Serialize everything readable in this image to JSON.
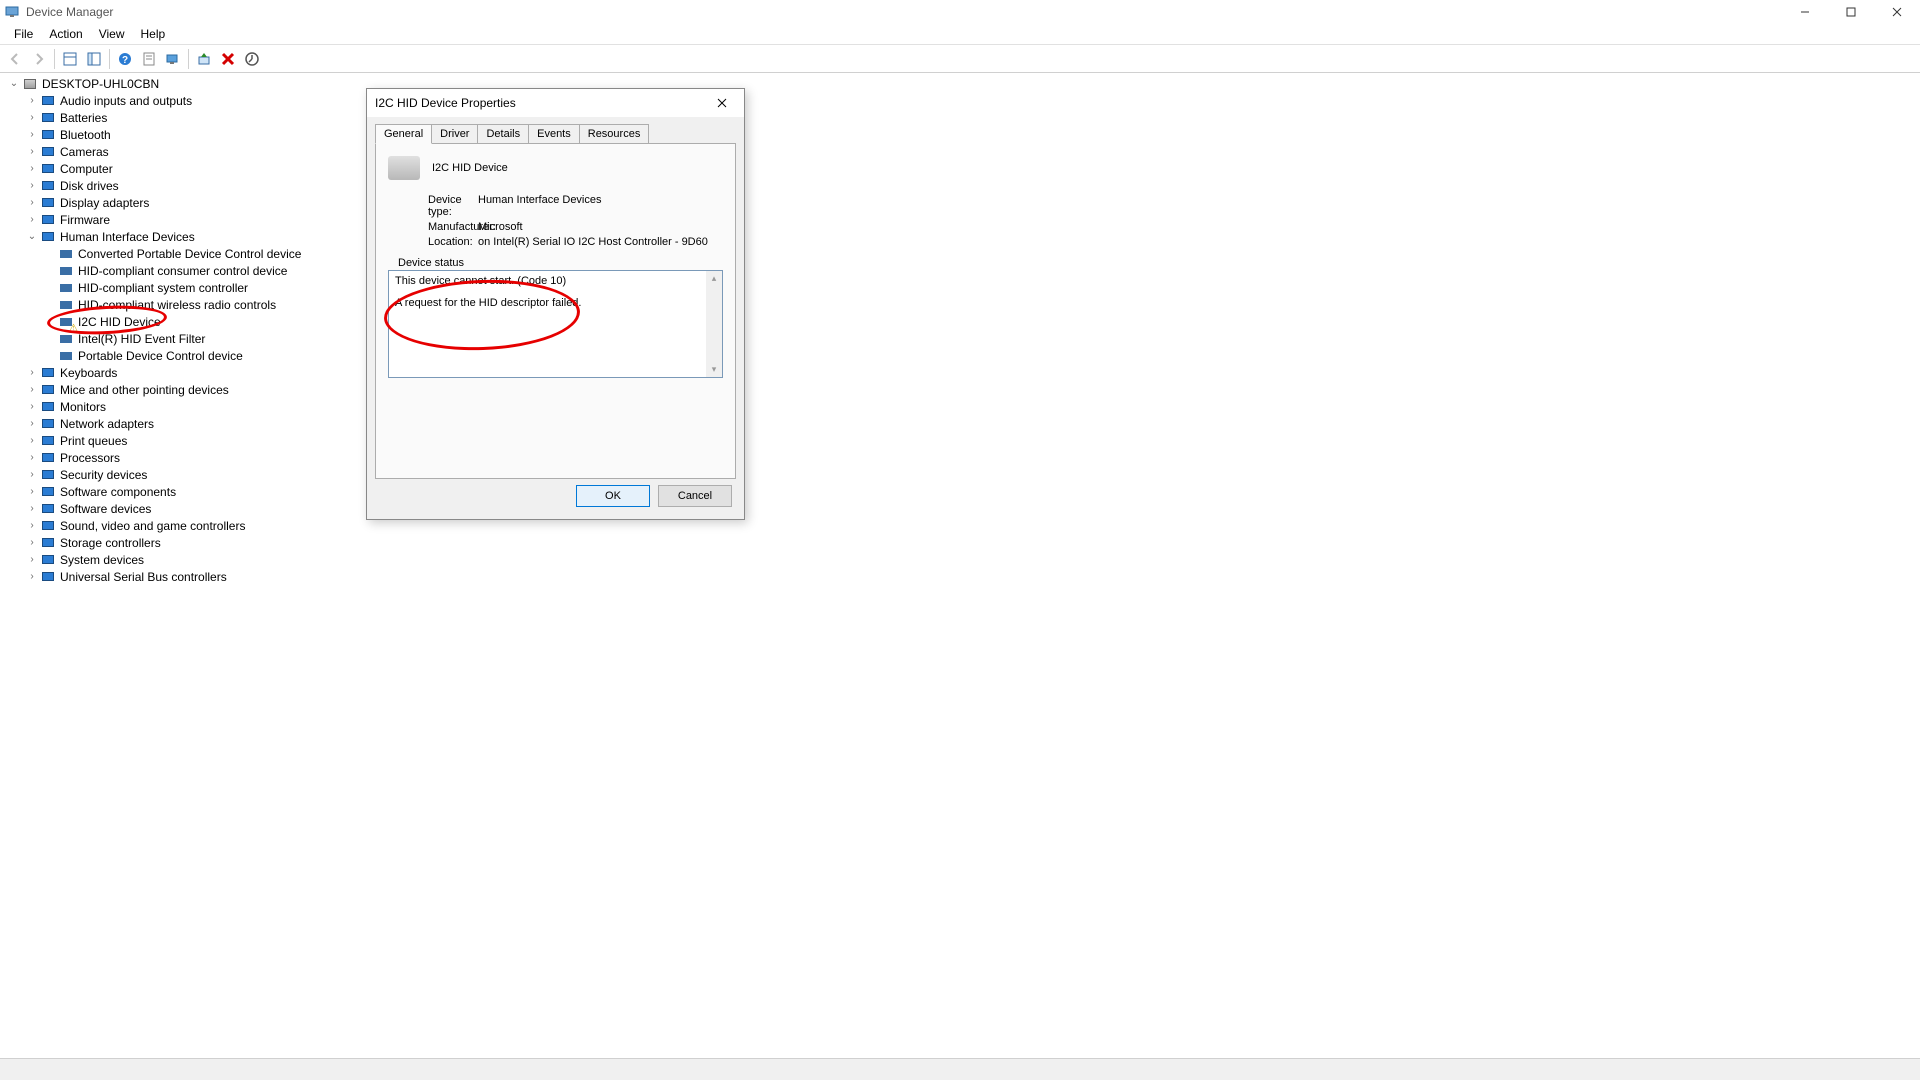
{
  "window": {
    "title": "Device Manager"
  },
  "menu": [
    "File",
    "Action",
    "View",
    "Help"
  ],
  "tree": {
    "root": "DESKTOP-UHL0CBN",
    "groups": [
      "Audio inputs and outputs",
      "Batteries",
      "Bluetooth",
      "Cameras",
      "Computer",
      "Disk drives",
      "Display adapters",
      "Firmware",
      "Human Interface Devices",
      "Keyboards",
      "Mice and other pointing devices",
      "Monitors",
      "Network adapters",
      "Print queues",
      "Processors",
      "Security devices",
      "Software components",
      "Software devices",
      "Sound, video and game controllers",
      "Storage controllers",
      "System devices",
      "Universal Serial Bus controllers"
    ],
    "hid_children": [
      "Converted Portable Device Control device",
      "HID-compliant consumer control device",
      "HID-compliant system controller",
      "HID-compliant wireless radio controls",
      "I2C HID Device",
      "Intel(R) HID Event Filter",
      "Portable Device Control device"
    ],
    "hid_warning_index": 4
  },
  "dialog": {
    "title": "I2C HID Device Properties",
    "tabs": [
      "General",
      "Driver",
      "Details",
      "Events",
      "Resources"
    ],
    "active_tab": 0,
    "device_name": "I2C HID Device",
    "rows": {
      "device_type_label": "Device type:",
      "device_type_value": "Human Interface Devices",
      "manufacturer_label": "Manufacturer:",
      "manufacturer_value": "Microsoft",
      "location_label": "Location:",
      "location_value": "on Intel(R) Serial IO I2C Host Controller - 9D60"
    },
    "status_legend": "Device status",
    "status_line1": "This device cannot start. (Code 10)",
    "status_line2": "A request for the HID descriptor failed.",
    "ok": "OK",
    "cancel": "Cancel"
  }
}
